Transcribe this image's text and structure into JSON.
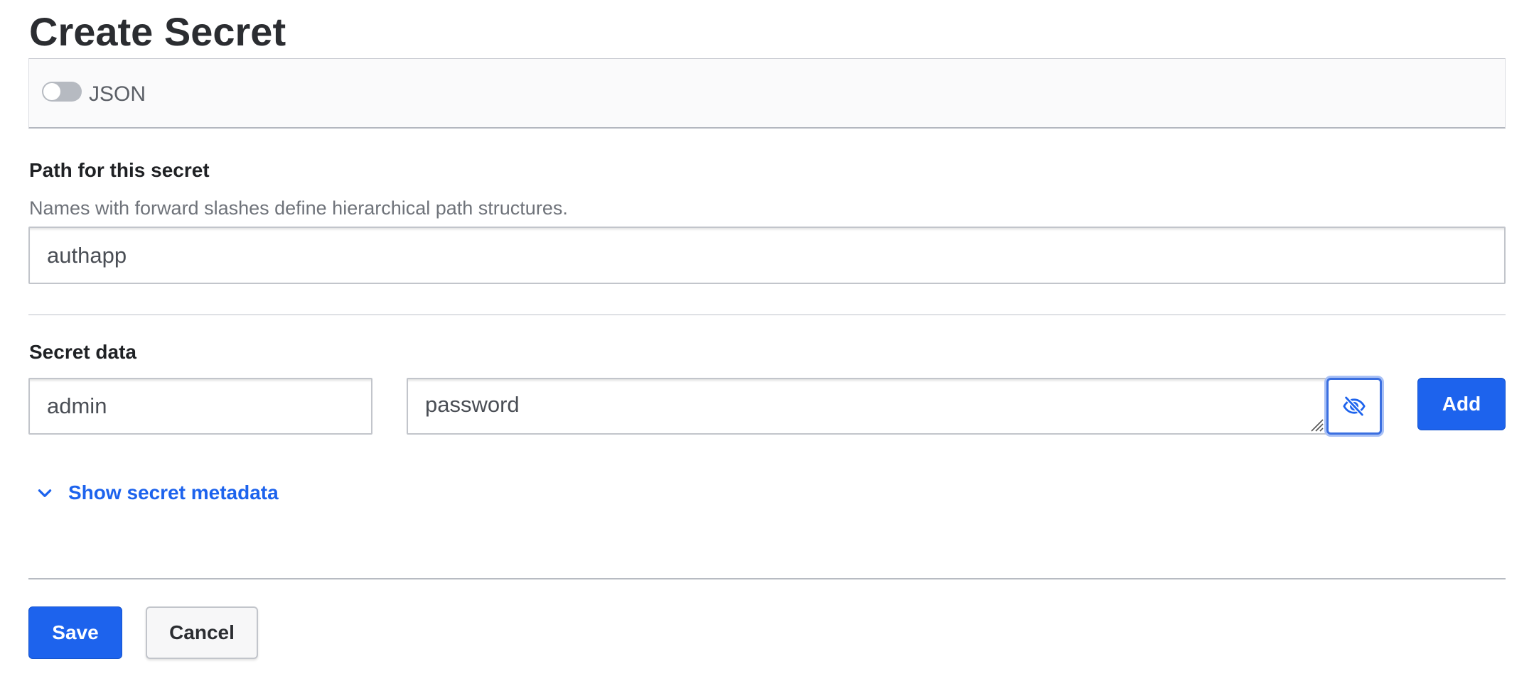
{
  "page": {
    "title": "Create Secret"
  },
  "json_toggle": {
    "label": "JSON",
    "enabled": false
  },
  "path": {
    "label": "Path for this secret",
    "help": "Names with forward slashes define hierarchical path structures.",
    "value": "authapp"
  },
  "secret_data": {
    "label": "Secret data",
    "key_value": "admin",
    "value_value": "password",
    "reveal_icon": "eye-slash-icon",
    "add_label": "Add"
  },
  "metadata": {
    "link_label": "Show secret metadata",
    "icon": "chevron-down-icon"
  },
  "actions": {
    "save_label": "Save",
    "cancel_label": "Cancel"
  },
  "colors": {
    "primary": "#1d63ed",
    "focus_ring": "#3b6fe0",
    "toggle_off": "#b6bac1"
  }
}
